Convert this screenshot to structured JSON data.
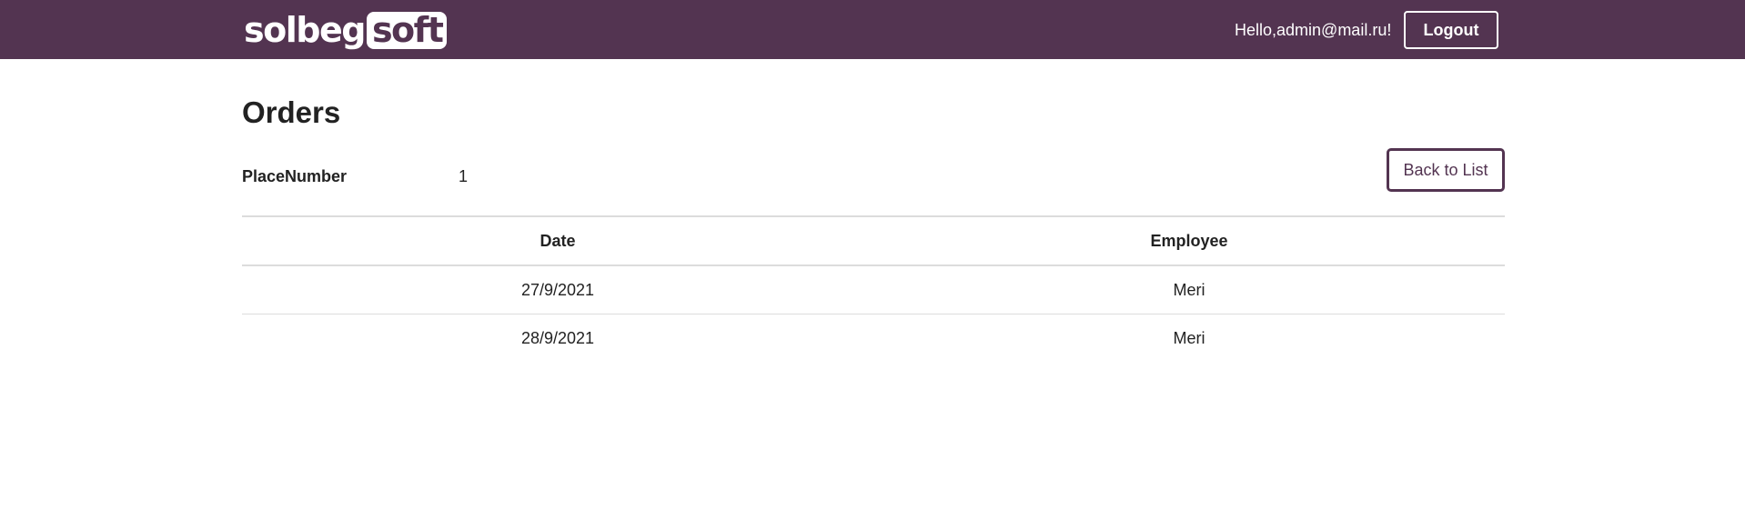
{
  "header": {
    "logo": {
      "left": "solbeg",
      "right": "soft"
    },
    "greeting": "Hello,admin@mail.ru!",
    "logout_label": "Logout",
    "colors": {
      "brand": "#533451",
      "text_on_brand": "#ffffff"
    }
  },
  "main": {
    "title": "Orders",
    "field": {
      "label": "PlaceNumber",
      "value": "1"
    },
    "back_label": "Back to List",
    "table": {
      "headers": [
        "Date",
        "Employee"
      ],
      "rows": [
        {
          "date": "27/9/2021",
          "employee": "Meri"
        },
        {
          "date": "28/9/2021",
          "employee": "Meri"
        }
      ]
    }
  }
}
